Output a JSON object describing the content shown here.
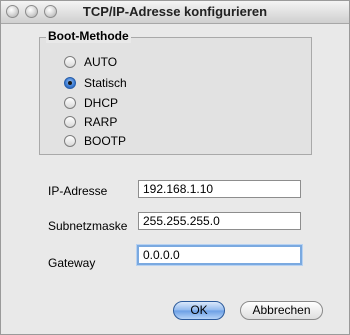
{
  "window": {
    "title": "TCP/IP-Adresse konfigurieren"
  },
  "boot": {
    "title": "Boot-Methode",
    "options": [
      {
        "label": "AUTO",
        "selected": false
      },
      {
        "label": "Statisch",
        "selected": true
      },
      {
        "label": "DHCP",
        "selected": false
      },
      {
        "label": "RARP",
        "selected": false
      },
      {
        "label": "BOOTP",
        "selected": false
      }
    ]
  },
  "fields": {
    "ip_label": "IP-Adresse",
    "ip_value": "192.168.1.10",
    "subnet_label": "Subnetzmaske",
    "subnet_value": "255.255.255.0",
    "gateway_label": "Gateway",
    "gateway_value": "0.0.0.0"
  },
  "buttons": {
    "ok": "OK",
    "cancel": "Abbrechen"
  }
}
